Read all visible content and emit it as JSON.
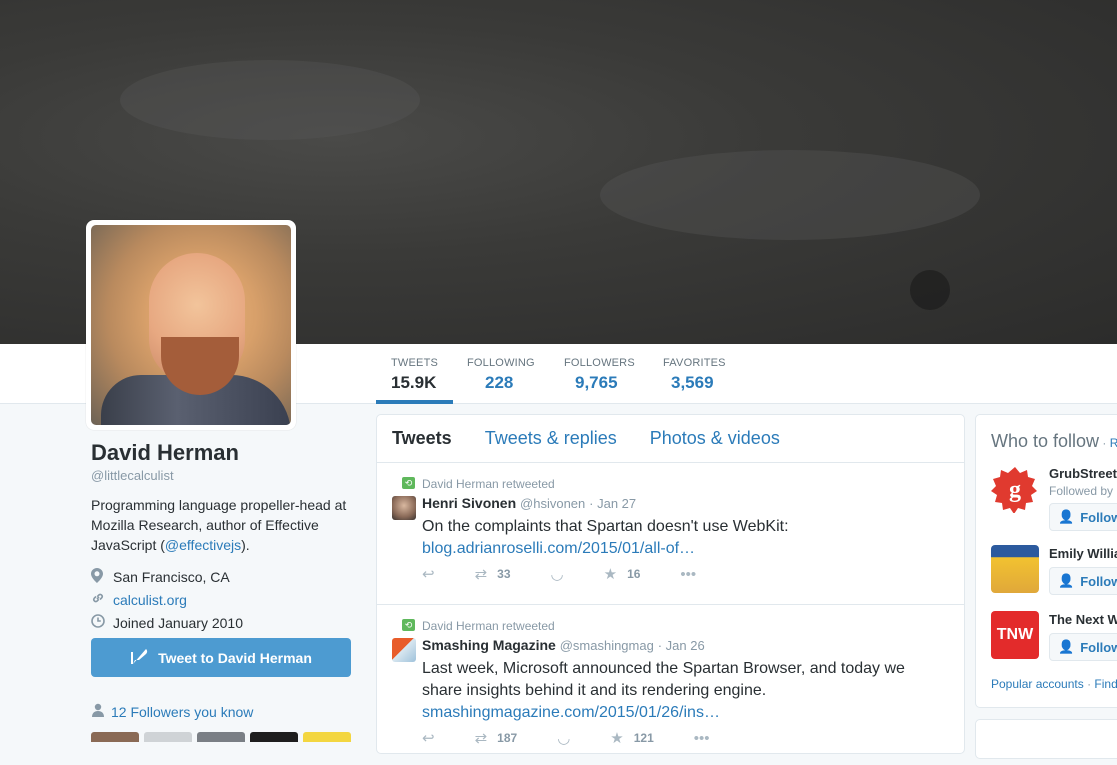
{
  "stats": [
    {
      "label": "TWEETS",
      "value": "15.9K"
    },
    {
      "label": "FOLLOWING",
      "value": "228"
    },
    {
      "label": "FOLLOWERS",
      "value": "9,765"
    },
    {
      "label": "FAVORITES",
      "value": "3,569"
    }
  ],
  "profile": {
    "name": "David Herman",
    "handle": "@littlecalculist",
    "bio_pre": "Programming language propeller-head at Mozilla Research, author of Effective JavaScript (",
    "bio_link": "@effectivejs",
    "bio_post": ").",
    "location": "San Francisco, CA",
    "website": "calculist.org",
    "joined": "Joined January 2010",
    "tweet_to_label": "Tweet to David Herman",
    "followers_you_know": "12 Followers you know"
  },
  "timeline": {
    "tabs": [
      "Tweets",
      "Tweets & replies",
      "Photos & videos"
    ],
    "tweets": [
      {
        "retweeted_by": "David Herman retweeted",
        "author": "Henri Sivonen",
        "handle": "@hsivonen",
        "date": "· Jan 27",
        "text": "On the complaints that Spartan doesn't use WebKit:",
        "link": "blog.adrianroselli.com/2015/01/all-of…",
        "retweets": "33",
        "favorites": "16"
      },
      {
        "retweeted_by": "David Herman retweeted",
        "author": "Smashing Magazine",
        "handle": "@smashingmag",
        "date": "· Jan 26",
        "text": "Last week, Microsoft announced the Spartan Browser, and today we share insights behind it and its rendering engine.",
        "link": "smashingmagazine.com/2015/01/26/ins…",
        "retweets": "187",
        "favorites": "121"
      }
    ]
  },
  "who_to_follow": {
    "title": "Who to follow",
    "sep": " · ",
    "refresh": "Re",
    "suggestions": [
      {
        "name": "GrubStreet",
        "sub": "Followed by",
        "button": "Follow"
      },
      {
        "name": "Emily Willia",
        "sub": "",
        "button": "Follow"
      },
      {
        "name": "The Next W",
        "sub": "",
        "button": "Follow"
      }
    ],
    "footer_popular": "Popular accounts",
    "footer_sep": " · ",
    "footer_find": "Find"
  },
  "icons": {
    "location": "map-pin-icon",
    "link": "link-icon",
    "clock": "clock-icon",
    "quill": "quill-icon",
    "person": "person-icon",
    "reply": "reply-icon",
    "retweet": "retweet-icon",
    "favorite": "star-icon",
    "more": "more-icon"
  },
  "colors": {
    "accent": "#2b7bb9",
    "button": "#4d9bd1",
    "retweet_green": "#5fb85c"
  }
}
